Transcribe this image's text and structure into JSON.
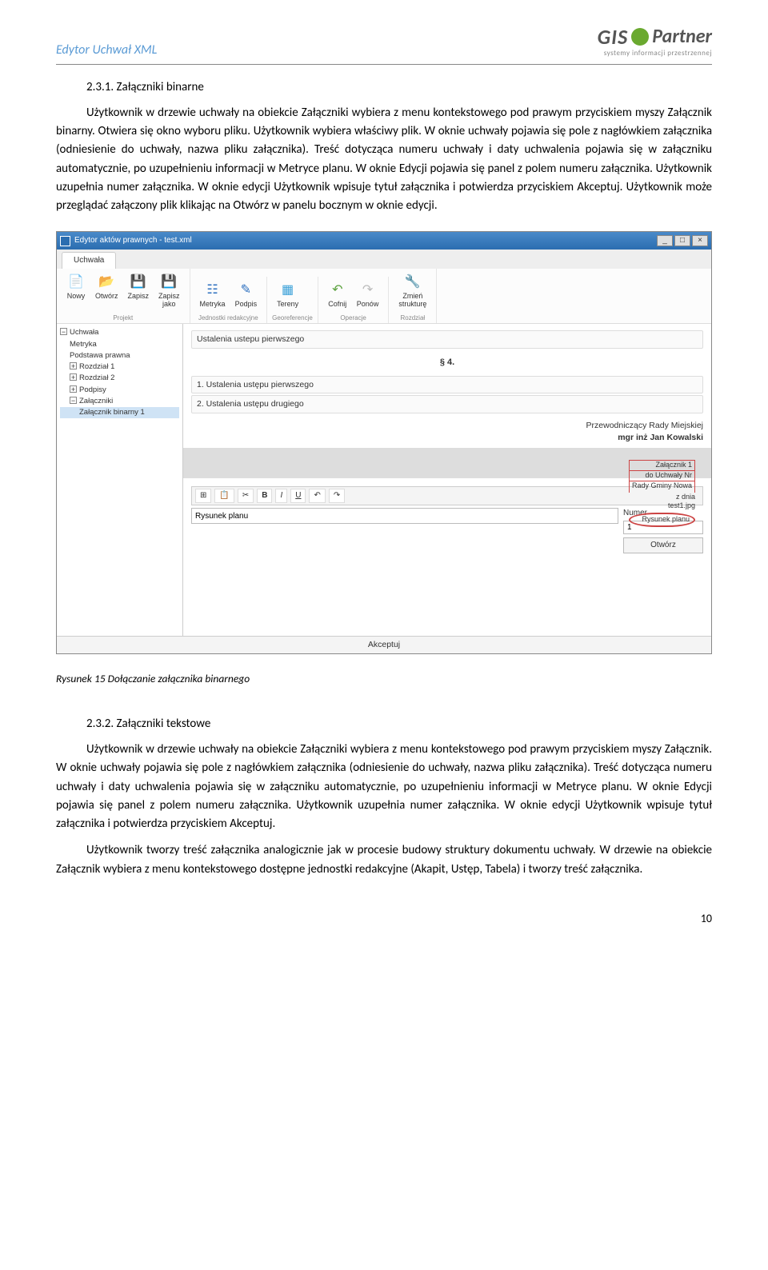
{
  "header": {
    "title": "Edytor Uchwał XML",
    "logo_gis": "GIS",
    "logo_partner": "Partner",
    "logo_sub": "systemy  informacji  przestrzennej"
  },
  "sec1": {
    "heading": "2.3.1. Załączniki binarne",
    "body": "Użytkownik w drzewie uchwały na obiekcie Załączniki wybiera z menu kontekstowego pod prawym przyciskiem myszy Załącznik binarny. Otwiera się okno wyboru pliku. Użytkownik wybiera właściwy plik. W oknie uchwały pojawia się pole z nagłówkiem załącznika (odniesienie do uchwały, nazwa pliku załącznika). Treść dotycząca numeru uchwały i daty uchwalenia pojawia się w załączniku automatycznie, po uzupełnieniu informacji w Metryce planu. W oknie Edycji pojawia się panel z polem numeru załącznika. Użytkownik uzupełnia numer załącznika. W oknie edycji Użytkownik wpisuje tytuł załącznika i potwierdza przyciskiem Akceptuj. Użytkownik może przeglądać załączony plik klikając na Otwórz w panelu bocznym w oknie edycji."
  },
  "app": {
    "title": "Edytor aktów prawnych - test.xml",
    "tab": "Uchwała",
    "ribbon": {
      "nowy": "Nowy",
      "otworz": "Otwórz",
      "zapisz": "Zapisz",
      "zapisz_jako": "Zapisz\njako",
      "metryka": "Metryka",
      "podpis": "Podpis",
      "tereny": "Tereny",
      "cofnij": "Cofnij",
      "ponow": "Ponów",
      "zmien": "Zmień\nstrukturę",
      "g1": "Projekt",
      "g2": "Jednostki redakcyjne",
      "g3": "Georeferencje",
      "g4": "Operacje",
      "g5": "Rozdział"
    },
    "tree": {
      "uchwala": "Uchwała",
      "metryka": "Metryka",
      "podstawa": "Podstawa prawna",
      "r1": "Rozdział 1",
      "r2": "Rozdział 2",
      "podpisy": "Podpisy",
      "zalaczniki": "Załączniki",
      "binarny1": "Załącznik binarny 1"
    },
    "doc": {
      "row1": "Ustalenia ustepu pierwszego",
      "para": "§ 4.",
      "row2": "1. Ustalenia ustępu pierwszego",
      "row3": "2. Ustalenia ustępu drugiego",
      "sign_role": "Przewodniczący Rady Miejskiej",
      "sign_name": "mgr inż Jan Kowalski",
      "meta_l1": "Załącznik 1",
      "meta_l2": "do Uchwały Nr",
      "meta_l3": "Rady Gminy Nowa",
      "meta_l4": "z dnia",
      "meta_l5": "test1.jpg",
      "meta_l6": "Rysunek planu"
    },
    "editor": {
      "title_input": "Rysunek planu",
      "num_label": "Numer",
      "num_value": "1",
      "open_btn": "Otwórz",
      "accept": "Akceptuj"
    }
  },
  "figure_caption": "Rysunek 15 Dołączanie załącznika binarnego",
  "sec2": {
    "heading": "2.3.2. Załączniki tekstowe",
    "p1": "Użytkownik w drzewie uchwały na obiekcie Załączniki wybiera z menu kontekstowego pod prawym przyciskiem myszy Załącznik. W oknie uchwały pojawia się pole z nagłówkiem załącznika (odniesienie do uchwały, nazwa pliku załącznika). Treść dotycząca numeru uchwały i daty uchwalenia pojawia się w załączniku automatycznie, po uzupełnieniu informacji w Metryce planu. W oknie Edycji pojawia się panel z polem numeru załącznika. Użytkownik uzupełnia numer załącznika. W oknie edycji Użytkownik wpisuje tytuł załącznika i potwierdza przyciskiem Akceptuj.",
    "p2": "Użytkownik tworzy treść załącznika analogicznie jak w procesie budowy struktury dokumentu uchwały. W drzewie na obiekcie Załącznik wybiera z menu kontekstowego dostępne jednostki redakcyjne (Akapit, Ustęp, Tabela) i tworzy treść załącznika."
  },
  "page_number": "10"
}
